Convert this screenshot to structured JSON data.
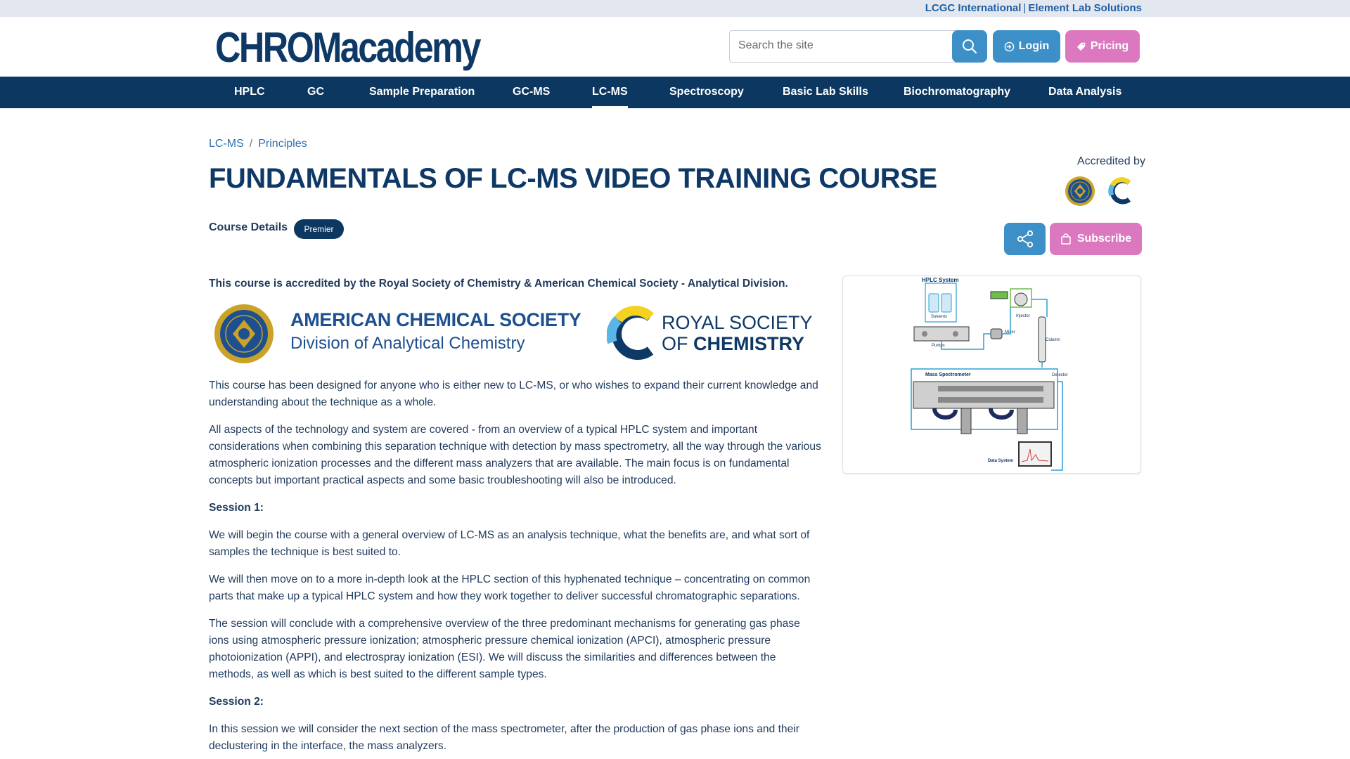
{
  "topbar": {
    "link1": "LCGC International",
    "separator": "|",
    "link2": "Element Lab Solutions"
  },
  "header": {
    "logo_text": "CHROMacademy",
    "search_placeholder": "Search the site",
    "login_label": "Login",
    "pricing_label": "Pricing"
  },
  "nav": {
    "items": [
      {
        "label": "HPLC"
      },
      {
        "label": "GC"
      },
      {
        "label": "Sample Preparation"
      },
      {
        "label": "GC-MS"
      },
      {
        "label": "LC-MS"
      },
      {
        "label": "Spectroscopy"
      },
      {
        "label": "Basic Lab Skills"
      },
      {
        "label": "Biochromatography"
      },
      {
        "label": "Data Analysis"
      }
    ],
    "active": "LC-MS"
  },
  "breadcrumb": {
    "item1": "LC-MS",
    "separator": "/",
    "item2": "Principles"
  },
  "page": {
    "title": "FUNDAMENTALS OF LC-MS VIDEO TRAINING COURSE",
    "accredited_label": "Accredited by",
    "course_details_label": "Course Details",
    "badge": "Premier",
    "subscribe_label": "Subscribe"
  },
  "logos": {
    "acs_line1": "AMERICAN CHEMICAL SOCIETY",
    "acs_line2": "Division of Analytical Chemistry",
    "rsc_line1": "ROYAL SOCIETY",
    "rsc_line2_prefix": "OF ",
    "rsc_line2_bold": "CHEMISTRY"
  },
  "content": {
    "accreditation": "This course is accredited by the Royal Society of Chemistry & American Chemical Society - Analytical Division.",
    "intro1": "This course has been designed for anyone who is either new to LC-MS, or who wishes to expand their current knowledge and understanding about the technique as a whole.",
    "intro2": "All aspects of the technology and system are covered - from an overview of a typical HPLC system and important considerations when combining this separation technique with detection by mass spectrometry, all the way through the various atmospheric ionization processes and the different mass analyzers that are available. The main focus is on fundamental concepts but important practical aspects and some basic troubleshooting will also be introduced.",
    "session1_heading": "Session 1:",
    "session1_p1": "We will begin the course with a general overview of LC-MS as an analysis technique, what the benefits are, and what sort of samples the technique is best suited to.",
    "session1_p2": "We will then move on to a more in-depth look at the HPLC section of this hyphenated technique – concentrating on common parts that make up a typical HPLC system and how they work together to deliver successful chromatographic separations.",
    "session1_p3": "The session will conclude with a comprehensive overview of the three predominant mechanisms for generating gas phase ions using atmospheric pressure ionization; atmospheric pressure chemical ionization (APCI), atmospheric pressure photoionization (APPI), and electrospray ionization (ESI). We will discuss the similarities and differences between the methods, as well as which is best suited to the different sample types.",
    "session2_heading": "Session 2:",
    "session2_p1": "In this session we will consider the next section of the mass spectrometer, after the production of gas phase ions and their declustering in the interface, the mass analyzers."
  },
  "diagram": {
    "hplc_system": "HPLC System",
    "solvents": "Solvents",
    "pumps": "Pumps",
    "mixer": "Mixer",
    "injector": "Injector",
    "column": "Column",
    "mass_spectrometer": "Mass Spectrometer",
    "detector": "Detector",
    "data_system": "Data System"
  },
  "colors": {
    "nav_bg": "#0b3761",
    "accent_blue": "#3d8fc7",
    "accent_pink": "#dc78bf",
    "title_blue": "#0e3866",
    "link_blue": "#2f6fb0"
  },
  "icons": {
    "search": "search-icon",
    "login": "login-icon",
    "pricing": "tag-icon",
    "share": "share-icon",
    "subscribe": "shopping-bag-icon"
  }
}
